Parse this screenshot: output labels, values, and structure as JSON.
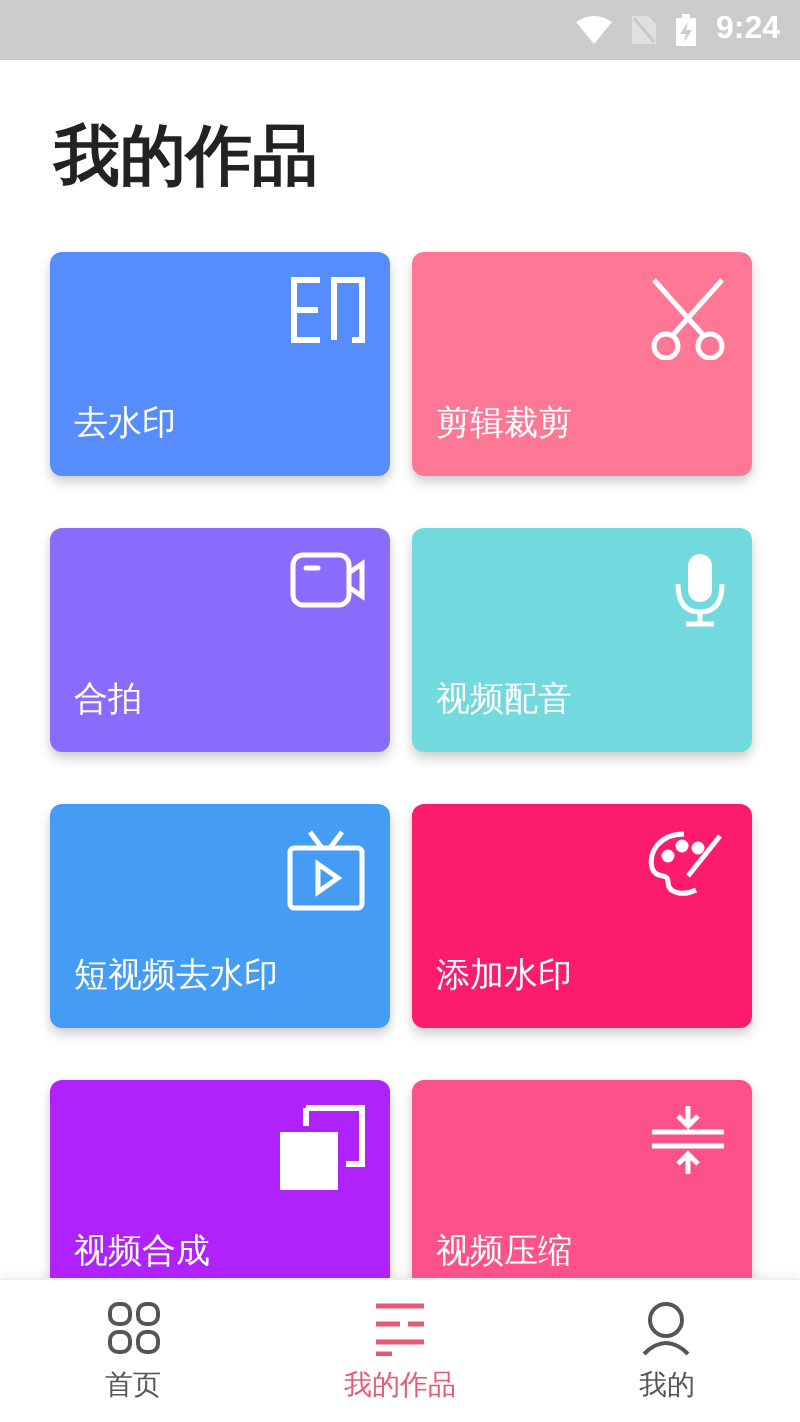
{
  "status_bar": {
    "time": "9:24"
  },
  "title": "我的作品",
  "cards": [
    {
      "label": "去水印",
      "color": "#568cfc"
    },
    {
      "label": "剪辑裁剪",
      "color": "#fe7896"
    },
    {
      "label": "合拍",
      "color": "#8a6cfd"
    },
    {
      "label": "视频配音",
      "color": "#72d9df"
    },
    {
      "label": "短视频去水印",
      "color": "#449cf5"
    },
    {
      "label": "添加水印",
      "color": "#fd1b6e"
    },
    {
      "label": "视频合成",
      "color": "#b022fc"
    },
    {
      "label": "视频压缩",
      "color": "#fd5189"
    }
  ],
  "tabs": [
    {
      "label": "首页",
      "selected": false
    },
    {
      "label": "我的作品",
      "selected": true
    },
    {
      "label": "我的",
      "selected": false
    }
  ]
}
